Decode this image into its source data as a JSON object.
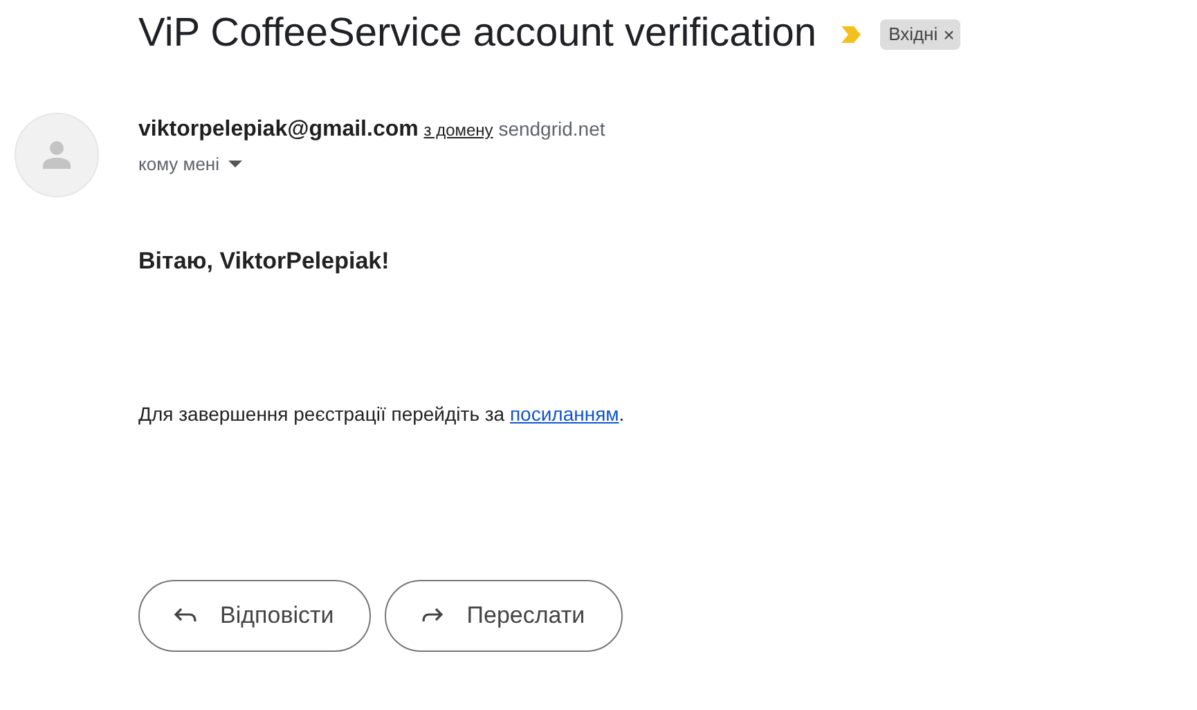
{
  "subject": "ViP CoffeeService account verification",
  "important": true,
  "label": {
    "text": "Вхідні",
    "close": "×"
  },
  "sender": {
    "email": "viktorpelepiak@gmail.com",
    "via": "з домену",
    "domain": "sendgrid.net",
    "recipient": "кому мені"
  },
  "body": {
    "greeting": "Вітаю, ViktorPelepiak!",
    "text": "Для завершення реєстрації перейдіть за ",
    "link": "посиланням",
    "after": "."
  },
  "buttons": [
    {
      "kind": "reply",
      "label": "Відповісти"
    },
    {
      "kind": "forward",
      "label": "Переслати"
    }
  ]
}
